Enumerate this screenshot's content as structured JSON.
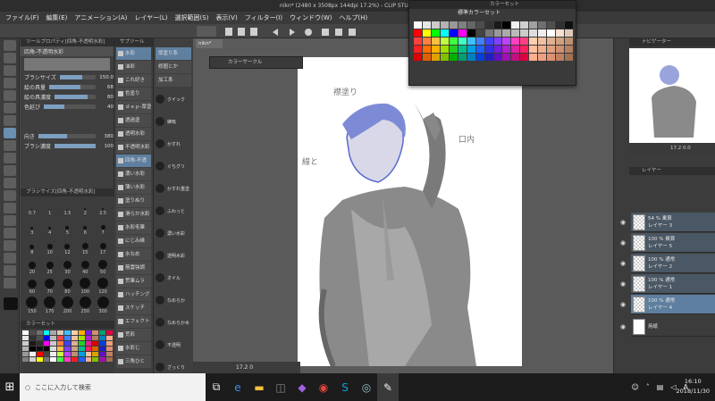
{
  "window": {
    "title": "nikn* (2480 x 3508px 144dpi 17.2%) - CLIP STUDIO PAINT"
  },
  "menu": [
    "ファイル(F)",
    "編集(E)",
    "アニメーション(A)",
    "レイヤー(L)",
    "選択範囲(S)",
    "表示(V)",
    "フィルター(I)",
    "ウィンドウ(W)",
    "ヘルプ(H)"
  ],
  "subtool": {
    "header": "ツールプロパティ[四角-不透明水彩]",
    "tool_name": "四角-不透明水彩",
    "props": [
      {
        "label": "ブラシサイズ",
        "value": "150.0",
        "fill": 0.62
      },
      {
        "label": "絵の具量",
        "value": "68",
        "fill": 0.68
      },
      {
        "label": "絵の具濃度",
        "value": "80",
        "fill": 0.8
      },
      {
        "label": "色延び",
        "value": "40",
        "fill": 0.4
      },
      {
        "label": "向き",
        "value": "380",
        "fill": 0.5
      },
      {
        "label": "ブラシ濃度",
        "value": "100",
        "fill": 1.0
      }
    ]
  },
  "brushsize": {
    "header": "ブラシサイズ[四角-不透明水彩]",
    "sizes": [
      "0.7",
      "1",
      "1.5",
      "2",
      "2.5",
      "3",
      "4",
      "5",
      "6",
      "7",
      "8",
      "10",
      "12",
      "15",
      "17",
      "20",
      "25",
      "30",
      "40",
      "50",
      "60",
      "70",
      "80",
      "100",
      "120",
      "150",
      "170",
      "200",
      "250",
      "300"
    ]
  },
  "palette": {
    "header": "カラーセット"
  },
  "toolprops": {
    "header": "サブツール",
    "items": [
      {
        "label": "水彩",
        "sel": true
      },
      {
        "label": "油彩",
        "sel": false
      },
      {
        "label": "これ好き",
        "sel": false
      },
      {
        "label": "色塗り",
        "sel": false
      },
      {
        "label": "ｄｅｐ-厚塗",
        "sel": false
      },
      {
        "label": "透過塗",
        "sel": false
      },
      {
        "label": "透明水彩",
        "sel": false
      },
      {
        "label": "不透明水彩",
        "sel": false
      },
      {
        "label": "四角-不透",
        "sel": true
      },
      {
        "label": "濃い水彩",
        "sel": false
      },
      {
        "label": "薄い水彩",
        "sel": false
      },
      {
        "label": "塗りぬり",
        "sel": false
      },
      {
        "label": "滑らか水彩",
        "sel": false
      },
      {
        "label": "水彩毛筆",
        "sel": false
      },
      {
        "label": "にじみ縁",
        "sel": false
      },
      {
        "label": "水なめ",
        "sel": false
      },
      {
        "label": "筋雲強調",
        "sel": false
      },
      {
        "label": "荒筆ムラ",
        "sel": false
      },
      {
        "label": "ハッチング",
        "sel": false
      },
      {
        "label": "スケッチ",
        "sel": false
      },
      {
        "label": "エフェクト",
        "sel": false
      },
      {
        "label": "荒彩",
        "sel": false
      },
      {
        "label": "水彩じ",
        "sel": false
      },
      {
        "label": "三角ひと",
        "sel": false
      }
    ]
  },
  "brushpanel": {
    "top": [
      {
        "label": "厚塗り系",
        "sel": true
      },
      {
        "label": "修圏とか",
        "sel": false
      },
      {
        "label": "加工系",
        "sel": false
      }
    ],
    "items": [
      "クイック",
      "練吸",
      "かすれ",
      "ぐちグリ",
      "かすれ重塗",
      "ふわっと",
      "濃い水彩",
      "透明水彩",
      "オイル",
      "なめらか",
      "なめらか水",
      "不透明",
      "ざっくり",
      "不透明"
    ]
  },
  "canvas": {
    "doc_tab": "nikn*",
    "zoom": "17.2",
    "angle": "0",
    "colorwheel_title": "カラーサークル"
  },
  "swatches": {
    "window_title": "カラーセット",
    "set_name": "標準カラーセット",
    "colors": [
      "#ffffff",
      "#e6e6e6",
      "#cccccc",
      "#b3b3b3",
      "#999999",
      "#808080",
      "#666666",
      "#4d4d4d",
      "#333333",
      "#1a1a1a",
      "#000000",
      "#f0f0f0",
      "#d0d0d0",
      "#a0a0a0",
      "#707070",
      "#505050",
      "#303030",
      "#101010",
      "#ff0000",
      "#ffff00",
      "#00ff00",
      "#00ffff",
      "#0000ff",
      "#ff00ff",
      "#000000",
      "#444444",
      "#777777",
      "#999999",
      "#aaaaaa",
      "#bbbbbb",
      "#cccccc",
      "#dddddd",
      "#eeeeee",
      "#ffffff",
      "#f6e0d0",
      "#e0c8b8",
      "#ff4040",
      "#ff8040",
      "#ffc040",
      "#c0ff40",
      "#40ff40",
      "#40ffc0",
      "#40c0ff",
      "#4080ff",
      "#4040ff",
      "#8040ff",
      "#c040ff",
      "#ff40c0",
      "#ff4080",
      "#ffd0b0",
      "#f0c0a0",
      "#e0b090",
      "#d0a080",
      "#c09070",
      "#ff2020",
      "#ff7000",
      "#ffb000",
      "#a0e000",
      "#20d020",
      "#00c090",
      "#00a0e0",
      "#2060ff",
      "#3030e0",
      "#7020e0",
      "#b020d0",
      "#e020a0",
      "#ff2060",
      "#ffc0a0",
      "#f0b090",
      "#e0a080",
      "#d09070",
      "#b08060",
      "#e00000",
      "#e06000",
      "#e0a000",
      "#80c000",
      "#00b000",
      "#00a070",
      "#0080c0",
      "#0040e0",
      "#2020c0",
      "#6010c0",
      "#a010b0",
      "#c01080",
      "#e00040",
      "#ffb090",
      "#f0a080",
      "#e09070",
      "#c08060",
      "#a07050"
    ]
  },
  "navigator": {
    "header": "ナビゲーター",
    "zoom": "17.2",
    "angle": "0.0"
  },
  "layers": {
    "header": "レイヤー",
    "items": [
      {
        "name": "レイヤー 3",
        "mode": "54 % 乗算",
        "sel": false
      },
      {
        "name": "レイヤー 5",
        "mode": "100 % 乗算",
        "sel": false
      },
      {
        "name": "レイヤー 2",
        "mode": "100 % 通常",
        "sel": false
      },
      {
        "name": "レイヤー 1",
        "mode": "100 % 通常",
        "sel": false
      },
      {
        "name": "レイヤー 4",
        "mode": "100 % 通常",
        "sel": true
      },
      {
        "name": "用紙",
        "mode": "",
        "sel": false
      }
    ]
  },
  "sketch_notes": [
    "襟塗り",
    "線と",
    "口内"
  ],
  "taskbar": {
    "search_placeholder": "ここに入力して検索",
    "time": "16:10",
    "date": "2018/11/30",
    "ime": "A"
  }
}
